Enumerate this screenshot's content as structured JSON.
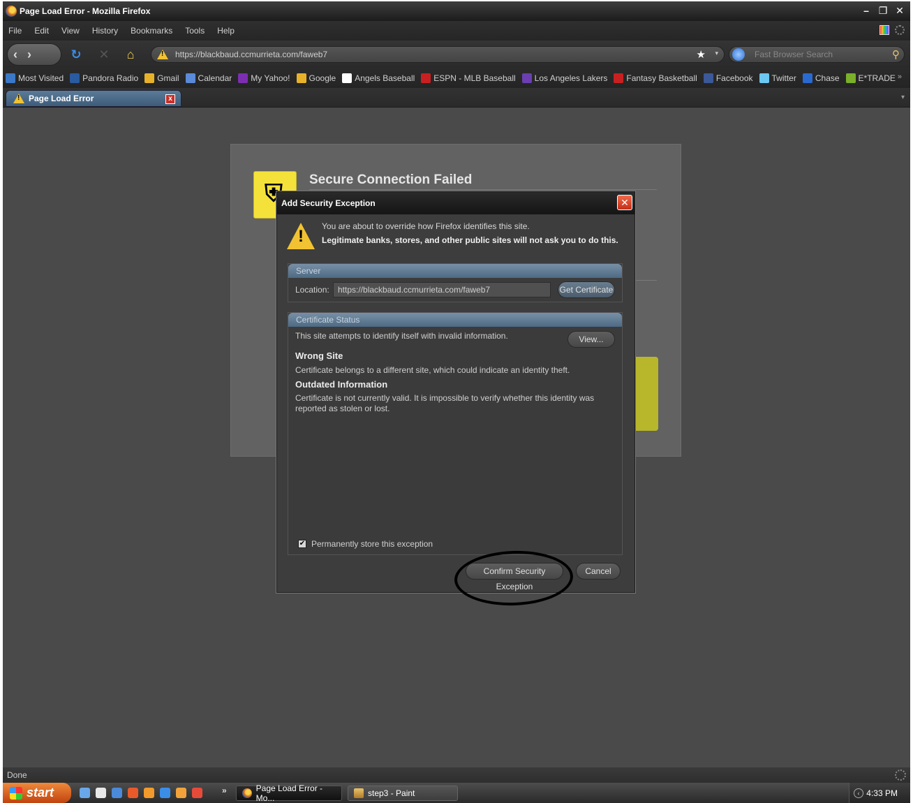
{
  "window": {
    "title": "Page Load Error - Mozilla Firefox"
  },
  "menu": {
    "items": [
      "File",
      "Edit",
      "View",
      "History",
      "Bookmarks",
      "Tools",
      "Help"
    ]
  },
  "nav": {
    "url": "https://blackbaud.ccmurrieta.com/faweb7",
    "search_placeholder": "Fast Browser Search"
  },
  "bookmarks": {
    "items": [
      {
        "label": "Most Visited",
        "color": "#3a78c8"
      },
      {
        "label": "Pandora Radio",
        "color": "#2a5aa0"
      },
      {
        "label": "Gmail",
        "color": "#e7b22a"
      },
      {
        "label": "Calendar",
        "color": "#5a8ad8"
      },
      {
        "label": "My Yahoo!",
        "color": "#7b2fb0"
      },
      {
        "label": "Google",
        "color": "#e7b22a"
      },
      {
        "label": "Angels Baseball",
        "color": "#ffffff"
      },
      {
        "label": "ESPN - MLB Baseball",
        "color": "#c82020"
      },
      {
        "label": "Los Angeles Lakers",
        "color": "#6b3fb0"
      },
      {
        "label": "Fantasy Basketball",
        "color": "#c82020"
      },
      {
        "label": "Facebook",
        "color": "#3b5998"
      },
      {
        "label": "Twitter",
        "color": "#6cc8f0"
      },
      {
        "label": "Chase",
        "color": "#2a6ad0"
      },
      {
        "label": "E*TRADE",
        "color": "#7ab02a"
      }
    ],
    "more": "»"
  },
  "tab": {
    "label": "Page Load Error"
  },
  "error_page": {
    "title": "Secure Connection Failed"
  },
  "dialog": {
    "title": "Add Security Exception",
    "message1": "You are about to override how Firefox identifies this site.",
    "message2": "Legitimate banks, stores, and other public sites will not ask you to do this.",
    "server": {
      "heading": "Server",
      "location_label": "Location:",
      "location_value": "https://blackbaud.ccmurrieta.com/faweb7",
      "get_certificate": "Get Certificate"
    },
    "cert_status": {
      "heading": "Certificate Status",
      "summary": "This site attempts to identify itself with invalid information.",
      "view_button": "View...",
      "wrong_site_title": "Wrong Site",
      "wrong_site_text": "Certificate belongs to a different site, which could indicate an identity theft.",
      "outdated_title": "Outdated Information",
      "outdated_text": "Certificate is not currently valid. It is impossible to verify whether this identity was reported as stolen or lost."
    },
    "permanent_label": "Permanently store this exception",
    "permanent_checked": true,
    "confirm_button": "Confirm Security Exception",
    "cancel_button": "Cancel"
  },
  "statusbar": {
    "text": "Done"
  },
  "taskbar": {
    "start": "start",
    "tasks": [
      "Page Load Error - Mo...",
      "step3 - Paint"
    ],
    "clock": "4:33 PM"
  }
}
